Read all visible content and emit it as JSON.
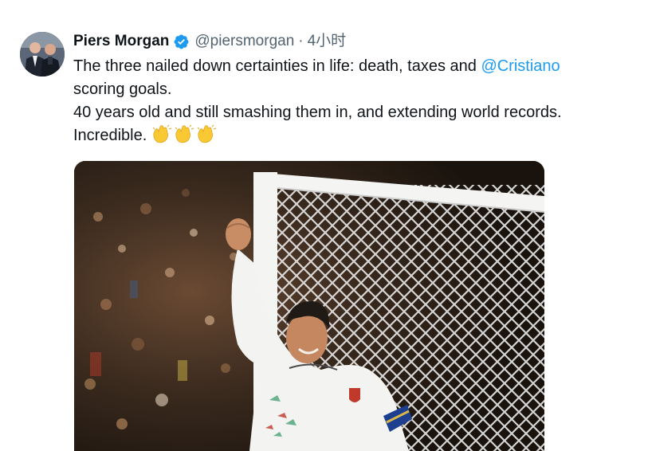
{
  "tweet": {
    "author": {
      "display_name": "Piers Morgan",
      "handle": "@piersmorgan",
      "verified": true,
      "verified_icon": "verified-badge-icon",
      "avatar_icon": "avatar"
    },
    "separator": "·",
    "time": "4小时",
    "text": {
      "line1_prefix": "The three nailed down certainties in life: death, taxes and ",
      "mention": "@Cristiano",
      "line1_suffix": " scoring goals.",
      "line2": "40 years old and still smashing them in, and extending world records.",
      "line3": "Incredible. ",
      "emoji": [
        "clapping-hands-icon",
        "clapping-hands-icon",
        "clapping-hands-icon"
      ]
    },
    "media": {
      "type": "photo",
      "subject": "photo-footballer-celebrating"
    }
  },
  "colors": {
    "text": "#0f1419",
    "secondary": "#536471",
    "link": "#1d9bf0",
    "verified": "#1d9bf0",
    "emoji": "#f9c933"
  }
}
